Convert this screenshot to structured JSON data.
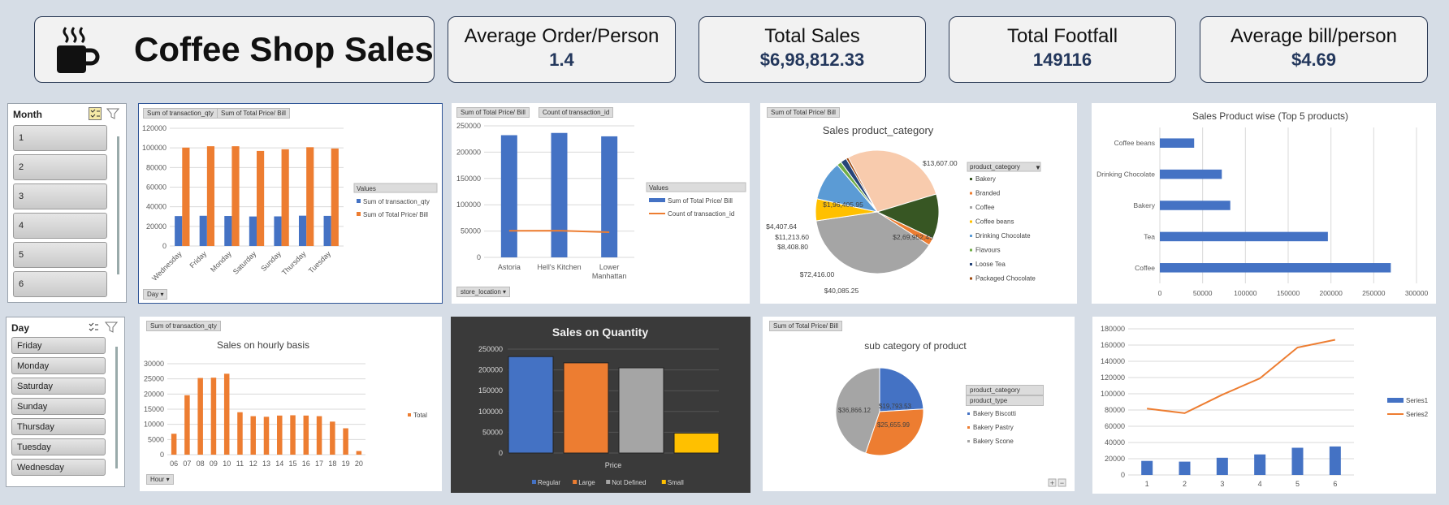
{
  "header": {
    "title": "Coffee Shop Sales",
    "kpis": [
      {
        "label": "Average Order/Person",
        "value": "1.4"
      },
      {
        "label": "Total Sales",
        "value": "$6,98,812.33"
      },
      {
        "label": "Total Footfall",
        "value": "149116"
      },
      {
        "label": "Average bill/person",
        "value": "$4.69"
      }
    ]
  },
  "slicers": {
    "month": {
      "title": "Month",
      "items": [
        "1",
        "2",
        "3",
        "4",
        "5",
        "6"
      ]
    },
    "day": {
      "title": "Day",
      "items": [
        "Friday",
        "Monday",
        "Saturday",
        "Sunday",
        "Thursday",
        "Tuesday",
        "Wednesday"
      ]
    }
  },
  "field_buttons": {
    "sum_qty": "Sum of transaction_qty",
    "sum_price": "Sum of Total Price/ Bill",
    "count_id": "Count of transaction_id",
    "day": "Day",
    "store_location": "store_location",
    "hour": "Hour",
    "product_category": "product_category",
    "product_type": "product_type",
    "values": "Values"
  },
  "chart_data": [
    {
      "id": "day_chart",
      "type": "bar",
      "categories": [
        "Wednesday",
        "Friday",
        "Monday",
        "Saturday",
        "Sunday",
        "Thursday",
        "Tuesday"
      ],
      "series": [
        {
          "name": "Sum of transaction_qty",
          "color": "#4472c4",
          "values": [
            30500,
            30800,
            30600,
            30100,
            30200,
            30900,
            30700
          ]
        },
        {
          "name": "Sum of Total Price/ Bill",
          "color": "#ed7d31",
          "values": [
            100300,
            101700,
            101700,
            96900,
            98600,
            100700,
            99400
          ]
        }
      ],
      "ylim": [
        0,
        120000
      ],
      "yticks": [
        "0",
        "20000",
        "40000",
        "60000",
        "80000",
        "100000",
        "120000"
      ],
      "legend_title": "Values"
    },
    {
      "id": "store_chart",
      "type": "bar",
      "categories": [
        "Astoria",
        "Hell's Kitchen",
        "Lower Manhattan"
      ],
      "series": [
        {
          "name": "Sum of Total Price/ Bill",
          "color": "#4472c4",
          "values": [
            232244,
            236511,
            230057
          ]
        },
        {
          "name": "Count of transaction_id",
          "color": "#ed7d31",
          "type": "line",
          "values": [
            50599,
            50735,
            47782
          ]
        }
      ],
      "ylim": [
        0,
        250000
      ],
      "yticks": [
        "0",
        "50000",
        "100000",
        "150000",
        "200000",
        "250000"
      ],
      "legend_title": "Values"
    },
    {
      "id": "category_pie",
      "type": "pie",
      "title": "Sales product_category",
      "legend_title": "product_category",
      "categories": [
        "Bakery",
        "Branded",
        "Coffee",
        "Coffee beans",
        "Drinking Chocolate",
        "Flavours",
        "Loose Tea",
        "Packaged Chocolate"
      ],
      "slices": [
        {
          "name": "Tea",
          "value": 196405.95,
          "label": "$1,96,405.95",
          "color": "#f8cbad"
        },
        {
          "name": "Bakery",
          "value": 82315.64,
          "label": "",
          "color": "#375623"
        },
        {
          "name": "Branded",
          "value": 13607.0,
          "label": "$13,607.00",
          "color": "#ed7d31"
        },
        {
          "name": "Coffee",
          "value": 269952.45,
          "label": "$2,69,952.45",
          "color": "#a5a5a5"
        },
        {
          "name": "Coffee beans",
          "value": 40085.25,
          "label": "$40,085.25",
          "color": "#ffc000"
        },
        {
          "name": "Drinking Chocolate",
          "value": 72416.0,
          "label": "$72,416.00",
          "color": "#5b9bd5"
        },
        {
          "name": "Flavours",
          "value": 8408.8,
          "label": "$8,408.80",
          "color": "#70ad47"
        },
        {
          "name": "Loose Tea",
          "value": 11213.6,
          "label": "$11,213.60",
          "color": "#264478"
        },
        {
          "name": "Packaged Chocolate",
          "value": 4407.64,
          "label": "$4,407.64",
          "color": "#9e480e"
        }
      ],
      "legend_colors": [
        "#375623",
        "#ed7d31",
        "#a5a5a5",
        "#ffc000",
        "#5b9bd5",
        "#70ad47",
        "#264478",
        "#9e480e"
      ]
    },
    {
      "id": "top5_chart",
      "type": "bar",
      "orientation": "horizontal",
      "title": "Sales Product wise (Top 5 products)",
      "categories": [
        "Coffee beans",
        "Drinking Chocolate",
        "Bakery",
        "Tea",
        "Coffee"
      ],
      "values": [
        40085,
        72416,
        82316,
        196406,
        269952
      ],
      "color": "#4472c4",
      "xlim": [
        0,
        300000
      ],
      "xticks": [
        "0",
        "50000",
        "100000",
        "150000",
        "200000",
        "250000",
        "300000"
      ]
    },
    {
      "id": "hourly_chart",
      "type": "bar",
      "title": "Sales on hourly basis",
      "categories": [
        "06",
        "07",
        "08",
        "09",
        "10",
        "11",
        "12",
        "13",
        "14",
        "15",
        "16",
        "17",
        "18",
        "19",
        "20"
      ],
      "values": [
        6900,
        19600,
        25300,
        25400,
        26700,
        14000,
        12700,
        12500,
        12900,
        13000,
        12900,
        12700,
        10900,
        8700,
        1200
      ],
      "color": "#ed7d31",
      "ylim": [
        0,
        30000
      ],
      "yticks": [
        "0",
        "5000",
        "10000",
        "15000",
        "20000",
        "25000",
        "30000"
      ],
      "legend": [
        "Total"
      ]
    },
    {
      "id": "size_chart",
      "type": "bar",
      "title": "Sales on Quantity",
      "xlabel": "Price",
      "series": [
        {
          "name": "Regular",
          "color": "#4472c4",
          "values": [
            232000
          ]
        },
        {
          "name": "Large",
          "color": "#ed7d31",
          "values": [
            217000
          ]
        },
        {
          "name": "Not Defined",
          "color": "#a5a5a5",
          "values": [
            205000
          ]
        },
        {
          "name": "Small",
          "color": "#ffc000",
          "values": [
            48000
          ]
        }
      ],
      "ylim": [
        0,
        250000
      ],
      "yticks": [
        "0",
        "50000",
        "100000",
        "150000",
        "200000",
        "250000"
      ]
    },
    {
      "id": "subcat_pie",
      "type": "pie",
      "title": "sub category of product",
      "slices": [
        {
          "name": "Bakery Biscotti",
          "value": 19793.53,
          "label": "$19,793.53",
          "color": "#4472c4"
        },
        {
          "name": "Bakery Pastry",
          "value": 25655.99,
          "label": "$25,655.99",
          "color": "#ed7d31"
        },
        {
          "name": "Bakery Scone",
          "value": 36866.12,
          "label": "$36,866.12",
          "color": "#a5a5a5"
        }
      ],
      "legend": [
        "Bakery Biscotti",
        "Bakery Pastry",
        "Bakery Scone"
      ]
    },
    {
      "id": "monthly_chart",
      "type": "bar",
      "categories": [
        "1",
        "2",
        "3",
        "4",
        "5",
        "6"
      ],
      "series": [
        {
          "name": "Series1",
          "color": "#4472c4",
          "values": [
            17300,
            16400,
            21200,
            25300,
            33500,
            35100
          ]
        },
        {
          "name": "Series2",
          "color": "#ed7d31",
          "type": "line",
          "values": [
            81700,
            76100,
            98800,
            119000,
            157000,
            166500
          ]
        }
      ],
      "ylim": [
        0,
        180000
      ],
      "yticks": [
        "0",
        "20000",
        "40000",
        "60000",
        "80000",
        "100000",
        "120000",
        "140000",
        "160000",
        "180000"
      ]
    }
  ]
}
